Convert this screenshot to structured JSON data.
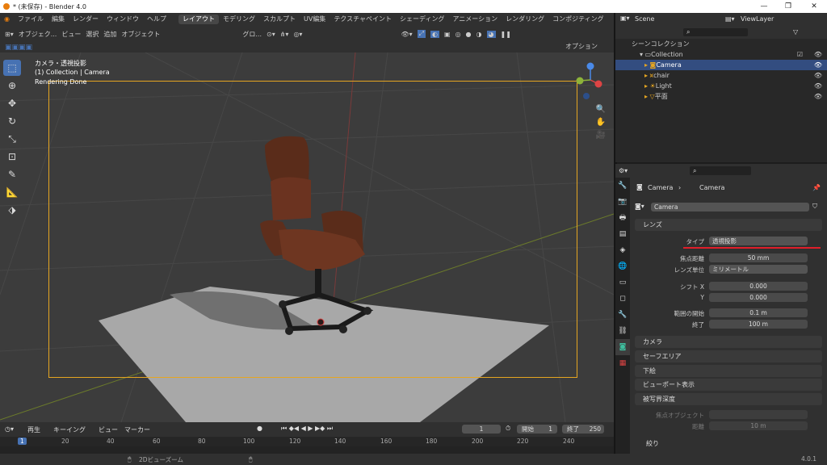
{
  "window": {
    "title": "* (未保存) - Blender 4.0"
  },
  "menu": {
    "items": [
      "ファイル",
      "編集",
      "レンダー",
      "ウィンドウ",
      "ヘルプ"
    ],
    "workspaces": [
      "レイアウト",
      "モデリング",
      "スカルプト",
      "UV編集",
      "テクスチャペイント",
      "シェーディング",
      "アニメーション",
      "レンダリング",
      "コンポジティング"
    ]
  },
  "viewport": {
    "header": {
      "mode": "オブジェク...",
      "view": "ビュー",
      "select": "選択",
      "add": "追加",
      "object": "オブジェクト",
      "orientation": "グロ..."
    },
    "options": "オプション",
    "overlay_title": "カメラ・透視投影",
    "overlay_collection": "(1) Collection | Camera",
    "overlay_status": "Rendering Done"
  },
  "outliner": {
    "scene_label": "Scene",
    "viewlayer_label": "ViewLayer",
    "root": "シーンコレクション",
    "collection": "Collection",
    "items": [
      {
        "name": "Camera",
        "selected": true
      },
      {
        "name": "chair",
        "selected": false
      },
      {
        "name": "Light",
        "selected": false
      },
      {
        "name": "平面",
        "selected": false
      }
    ]
  },
  "properties": {
    "breadcrumb_a": "Camera",
    "breadcrumb_b": "Camera",
    "data_name": "Camera",
    "lens_panel": "レンズ",
    "type_label": "タイプ",
    "type_value": "透視投影",
    "focal_label": "焦点距離",
    "focal_value": "50 mm",
    "unit_label": "レンズ単位",
    "unit_value": "ミリメートル",
    "shiftx_label": "シフト X",
    "shiftx_value": "0.000",
    "shifty_label": "Y",
    "shifty_value": "0.000",
    "clipstart_label": "範囲の開始",
    "clipstart_value": "0.1 m",
    "clipend_label": "終了",
    "clipend_value": "100 m",
    "panels": [
      "カメラ",
      "セーフエリア",
      "下絵",
      "ビューポート表示",
      "被写界深度"
    ],
    "focus_object_label": "焦点オブジェクト",
    "distance_label": "距離",
    "distance_value": "10 m",
    "aperture": "絞り"
  },
  "timeline": {
    "playback": "再生",
    "keying": "キーイング",
    "view": "ビュー",
    "marker": "マーカー",
    "current_frame": "1",
    "start_label": "開始",
    "start_value": "1",
    "end_label": "終了",
    "end_value": "250",
    "ticks": [
      "1",
      "20",
      "40",
      "60",
      "80",
      "100",
      "120",
      "140",
      "160",
      "180",
      "200",
      "220",
      "240"
    ]
  },
  "status": {
    "hint": "2Dビューズーム",
    "version": "4.0.1"
  },
  "colors": {
    "accent": "#4772b3",
    "selection": "#334d80",
    "camera_frame": "#e5a521",
    "annotation": "#e01e2a"
  }
}
